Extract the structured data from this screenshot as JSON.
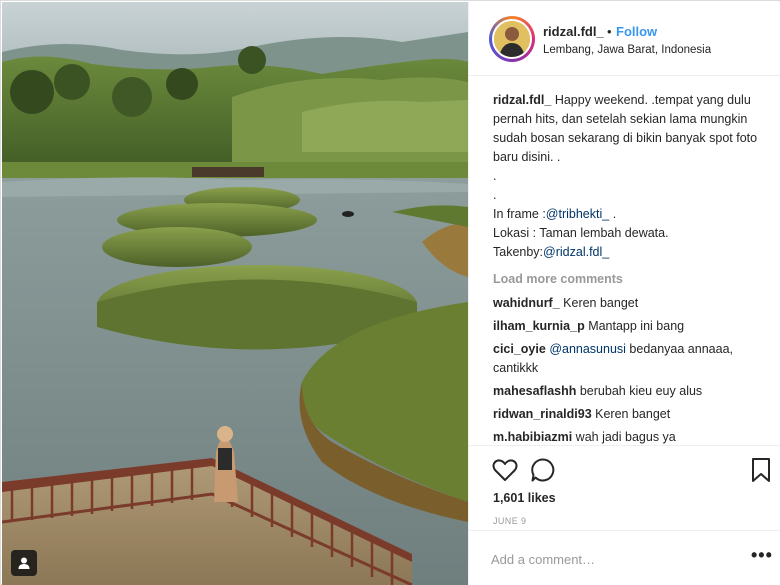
{
  "post": {
    "photo_icon": "user-tag-icon"
  },
  "header": {
    "username": "ridzal.fdl_",
    "separator": "•",
    "follow_label": "Follow",
    "location": "Lembang, Jawa Barat, Indonesia"
  },
  "caption": {
    "username": "ridzal.fdl_",
    "text": "Happy weekend. .tempat yang dulu pernah hits, dan setelah sekian lama mungkin sudah bosan sekarang di bikin banyak spot foto baru disini. .",
    "dot1": ".",
    "dot2": ".",
    "in_frame_label": "In frame :",
    "in_frame_mention": "@tribhekti_",
    "in_frame_suffix": " .",
    "lokasi": "Lokasi : Taman lembah dewata.",
    "takenby_label": "Takenby:",
    "takenby_mention": "@ridzal.fdl_"
  },
  "load_more": "Load more comments",
  "comments": [
    {
      "user": "wahidnurf_",
      "text": "Keren banget",
      "mention": ""
    },
    {
      "user": "ilham_kurnia_p",
      "text": "Mantapp ini bang",
      "mention": ""
    },
    {
      "user": "cici_oyie",
      "mention": "@annasunusi",
      "text": " bedanyaa annaaa, cantikkk"
    },
    {
      "user": "mahesaflashh",
      "text": "berubah kieu euy alus",
      "mention": ""
    },
    {
      "user": "ridwan_rinaldi93",
      "text": "Keren banget",
      "mention": ""
    },
    {
      "user": "m.habibiazmi",
      "text": "wah jadi bagus ya",
      "mention": ""
    }
  ],
  "actions": {
    "like_icon": "heart-icon",
    "comment_icon": "comment-bubble-icon",
    "save_icon": "bookmark-icon",
    "likes": "1,601 likes",
    "date": "JUNE 9"
  },
  "add_comment": {
    "placeholder": "Add a comment…",
    "more_label": "•••"
  },
  "colors": {
    "link": "#3897f0",
    "mention": "#003569",
    "muted": "#999999",
    "text": "#262626"
  }
}
